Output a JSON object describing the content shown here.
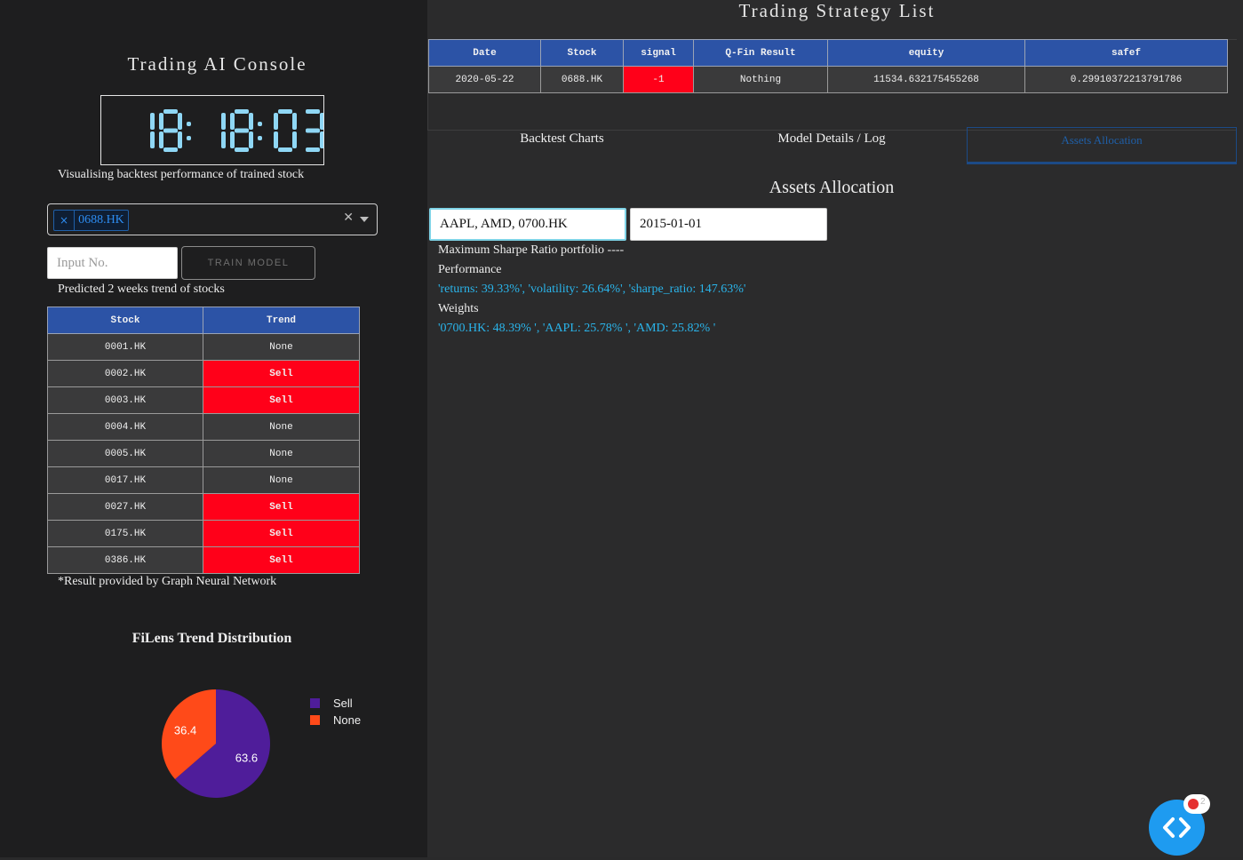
{
  "left_panel": {
    "title": "Trading AI Console",
    "clock": "18:18:03",
    "caption": "Visualising backtest performance of trained stock",
    "dropdown": {
      "selected": "0688.HK",
      "remove_glyph": "×",
      "clear_glyph": "✕"
    },
    "input_placeholder": "Input No.",
    "train_button": "TRAIN MODEL",
    "trend_caption": "Predicted 2 weeks trend of stocks",
    "trend_table": {
      "headers": [
        "Stock",
        "Trend"
      ],
      "rows": [
        [
          "0001.HK",
          "None"
        ],
        [
          "0002.HK",
          "Sell"
        ],
        [
          "0003.HK",
          "Sell"
        ],
        [
          "0004.HK",
          "None"
        ],
        [
          "0005.HK",
          "None"
        ],
        [
          "0017.HK",
          "None"
        ],
        [
          "0027.HK",
          "Sell"
        ],
        [
          "0175.HK",
          "Sell"
        ],
        [
          "0386.HK",
          "Sell"
        ]
      ]
    },
    "footnote": "*Result provided by Graph Neural Network",
    "pie_title": "FiLens Trend Distribution"
  },
  "chart_data": {
    "type": "pie",
    "title": "FiLens Trend Distribution",
    "categories": [
      "Sell",
      "None"
    ],
    "values": [
      63.6,
      36.4
    ],
    "colors": [
      "#4f1d9a",
      "#ff4a19"
    ],
    "legend_position": "right"
  },
  "right_panel": {
    "title": "Trading Strategy List",
    "strategy_table": {
      "headers": [
        "Date",
        "Stock",
        "signal",
        "Q-Fin Result",
        "equity",
        "safef"
      ],
      "rows": [
        [
          "2020-05-22",
          "0688.HK",
          "-1",
          "Nothing",
          "11534.632175455268",
          "0.29910372213791786"
        ]
      ]
    },
    "tabs": [
      {
        "label": "Backtest Charts",
        "active": false
      },
      {
        "label": "Model Details / Log",
        "active": false
      },
      {
        "label": "Assets Allocation",
        "active": true
      }
    ],
    "assets": {
      "title": "Assets Allocation",
      "tickers_value": "AAPL, AMD, 0700.HK",
      "date_value": "2015-01-01",
      "line1": "Maximum Sharpe Ratio portfolio ----",
      "line2": "Performance",
      "line3": "'returns: 39.33%', 'volatility: 26.64%', 'sharpe_ratio: 147.63%'",
      "line4": "Weights",
      "line5": "'0700.HK: 48.39% ', 'AAPL: 25.78% ', 'AMD: 25.82% '"
    }
  },
  "debug_badge": {
    "count": "2"
  },
  "colors": {
    "header_blue": "#2c53a6",
    "sell_red": "#ff0019",
    "fab_blue": "#1e9bf0"
  }
}
